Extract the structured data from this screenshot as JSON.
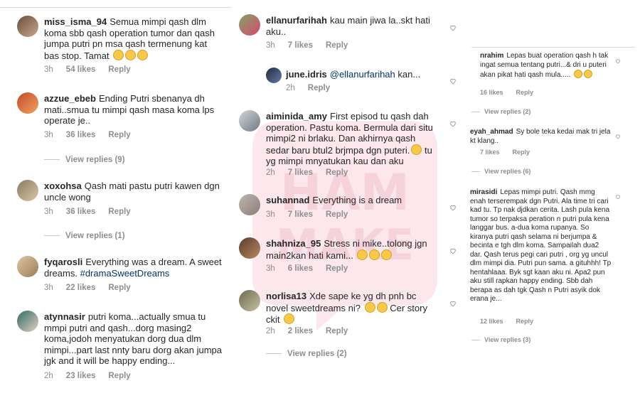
{
  "col1": {
    "comments": [
      {
        "user": "miss_isma_94",
        "text": "Semua mimpi qash dlm koma sbb qash operation tumor dan qash jumpa putri pn msa qash termenung kat bas stop. Tamat",
        "time": "3h",
        "likes": "54 likes",
        "reply": "Reply"
      },
      {
        "user": "azzue_ebeb",
        "text": "Ending Putri sbenanya dh mati..smua tu mimpi qash masa koma lps operate je..",
        "time": "3h",
        "likes": "36 likes",
        "reply": "Reply",
        "view_replies": "View replies (9)"
      },
      {
        "user": "xoxohsa",
        "text": "Qash mati pastu putri kawen dgn uncle wong",
        "time": "3h",
        "likes": "36 likes",
        "reply": "Reply",
        "view_replies": "View replies (1)"
      },
      {
        "user": "fyqarosli",
        "text": "Everything was a dream. A sweet dreams.",
        "hashtag": "#dramaSweetDreams",
        "time": "3h",
        "likes": "22 likes",
        "reply": "Reply"
      },
      {
        "user": "atynnasir",
        "text": "putri koma...actually smua tu mmpi putri and qash...dorg masing2 koma,jodoh menyatukan dorg dua dlm mimpi...part last nnty baru dorg akan jumpa jgk and it will be happy ending...",
        "time": "2h",
        "likes": "23 likes",
        "reply": "Reply"
      }
    ]
  },
  "col2": {
    "comments": [
      {
        "user": "ellanurfarihah",
        "text": "kau main jiwa la..skt hati aku..",
        "time": "3h",
        "likes": "7 likes",
        "reply": "Reply"
      },
      {
        "user": "june.idris",
        "mention": "@ellanurfarihah",
        "text": "kan...",
        "time": "2h",
        "likes": "",
        "reply": "Reply"
      },
      {
        "user": "aiminida_amy",
        "text": "First episod tu qash dah operation. Pastu koma. Bermula dari situ mimpi2 ni brlaku. Dan akhirnya qash sedar baru btul2 brjmpa dgn puteri.",
        "text2": "tu yg mimpi mnyatukan kau dan aku",
        "time": "2h",
        "likes": "7 likes",
        "reply": "Reply"
      },
      {
        "user": "suhannad",
        "text": "Everything is a dream",
        "time": "3h",
        "likes": "7 likes",
        "reply": "Reply"
      },
      {
        "user": "shahniza_95",
        "text": "Stress ni mike..tolong jgn main2kan hati kami...",
        "time": "3h",
        "likes": "6 likes",
        "reply": "Reply"
      },
      {
        "user": "norlisa13",
        "text": "Xde sape ke yg dh pnh bc novel sweetdreams ni?",
        "text2": "Cer story ckit",
        "time": "2h",
        "likes": "2 likes",
        "reply": "Reply",
        "view_replies": "View replies (2)"
      }
    ]
  },
  "col3": {
    "comments": [
      {
        "user": "nrahim",
        "text": "Lepas buat operation qash h tak ingat semua tentang putri...& dri u puteri akan pikat hati qash mula.....",
        "likes": "16 likes",
        "reply": "Reply",
        "view_replies": "View replies (2)"
      },
      {
        "user": "eyah_ahmad",
        "text": "Sy bole teka kedai mak tri jela kt klang..",
        "likes": "7 likes",
        "reply": "Reply",
        "view_replies": "View replies (6)"
      },
      {
        "user": "mirasidi",
        "text": "Lepas mimpi putri. Qash mmg enah terserempak dgn Putri. Ala time tri cari kad tu. Tp nak djdkan cerita. Lash pula kena tumor so terpaksa peration n putri pula kena langgar bus. a-dua koma rupanya. So kiranya putri qash selama ni berjumpa & becinta e tgh dlm koma. Sampailah dua2 dar. Qash terus pegi cari putri , org yg uncul dlm mimpi dia. Putri pun sama. a gituhhh! Tp hentahlaaa. Byk sgt kaan aku ni. Apa2 pun aku still rapkan happy ending. Sbb dah berapa as dah tgk Qash n Putri asyik dok erana je...",
        "likes": "12 likes",
        "reply": "Reply",
        "view_replies": "View replies (3)"
      }
    ]
  },
  "watermark": {
    "line1": "HAM",
    "line2": "MAKE"
  },
  "colors": {
    "text": "#262626",
    "meta": "#8e8e8e",
    "hashtag": "#003569",
    "divider": "#dbdbdb"
  },
  "icons": [
    "heart-icon",
    "avatar",
    "smile-emoji"
  ]
}
